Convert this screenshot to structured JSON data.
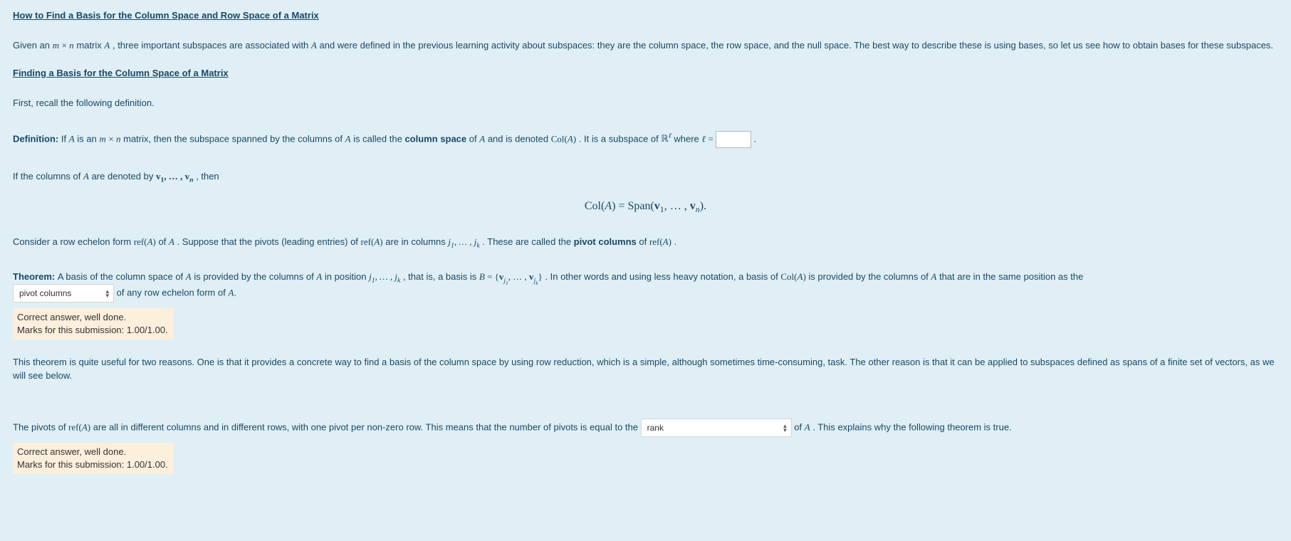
{
  "title": "How to Find a Basis for the Column Space and Row Space of a Matrix",
  "intro_before": "Given an ",
  "intro_mid": " matrix ",
  "intro_rest": ", three important subspaces are associated with ",
  "intro_tail": " and were defined in the previous learning activity about subspaces: they are the column space, the row space, and the null space. The best way to describe these is using bases, so let us see how to obtain bases for these subspaces.",
  "subhead": "Finding a  Basis for  the Column Space of a Matrix",
  "recall": "First, recall the following definition.",
  "def_label": "Definition:  ",
  "def_if": "If ",
  "def_isan": " is an ",
  "def_matrix_then": " matrix, then the subspace spanned by the columns of ",
  "def_called": " is called the ",
  "def_colspace": "column space",
  "def_of": " of ",
  "def_denoted": " and is denoted ",
  "def_subspace": ". It is a subspace of ",
  "def_where": " where ",
  "cols_denoted_a": "If the columns of ",
  "cols_denoted_b": " are denoted by ",
  "cols_then": ", then",
  "centered_eq_pref": "Col(",
  "centered_eq_a": "A",
  "centered_eq_mid": ") = Span(",
  "centered_eq_suffix": ").",
  "consider_a": "Consider a row echelon form ",
  "consider_of": " of ",
  "consider_suppose": ". Suppose that the pivots  (leading entries) of ",
  "consider_cols": " are in columns ",
  "consider_called": ". These are called the ",
  "pivot_cols_label": "pivot columns",
  "consider_ofref": " of ",
  "consider_dot": ".",
  "thm_label": "Theorem:  ",
  "thm_a": "A basis of the column space of ",
  "thm_b": " is provided by the columns of ",
  "thm_c": " in position ",
  "thm_d": ", that is, a basis is ",
  "thm_e": ". In other words and using less heavy notation, a basis of ",
  "thm_f": " is provided by the columns of ",
  "thm_g": " that are in the same position as the ",
  "select1_value": "pivot columns",
  "thm_tail": "of any row echelon form of ",
  "feedback_correct": "Correct answer, well done.",
  "feedback_marks": "Marks for this submission: 1.00/1.00.",
  "useful": "This theorem is quite useful for two reasons. One is that it provides a concrete way to find a basis of the column space by using row reduction, which is a simple, although sometimes time-consuming, task. The other reason is that it can be applied to subspaces defined as spans of a finite set of vectors, as we will see below.",
  "pivots_a": "The pivots of ",
  "pivots_b": " are all in different columns and in different rows, with one pivot per non-zero row. This means that the number of pivots is equal to the ",
  "select2_value": "rank",
  "pivots_c": "of ",
  "pivots_d": ". This explains why the following theorem is true."
}
